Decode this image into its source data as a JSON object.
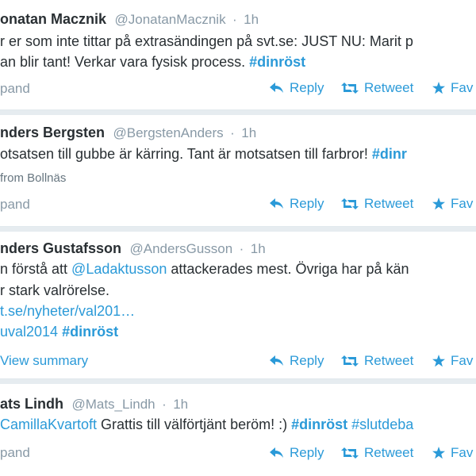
{
  "tweets": [
    {
      "name": "onatan Macznik",
      "handle": "@JonatanMacznik",
      "separator": "·",
      "time": "1h",
      "line1": "r er som inte tittar på extrasändingen på svt.se: JUST NU: Marit p",
      "line2_text": "an blir tant! Verkar vara fysisk process. ",
      "line2_hash": "#dinröst",
      "expand_label": "pand",
      "reply_label": "Reply",
      "retweet_label": "Retweet",
      "fav_label": "Fav"
    },
    {
      "name": "nders Bergsten",
      "handle": "@BergstenAnders",
      "separator": "·",
      "time": "1h",
      "line1_text": "otsatsen till gubbe är kärring. Tant är motsatsen till farbror! ",
      "line1_hash": "#dinr",
      "location": "from Bollnäs",
      "expand_label": "pand",
      "reply_label": "Reply",
      "retweet_label": "Retweet",
      "fav_label": "Fav"
    },
    {
      "name": "nders Gustafsson",
      "handle": "@AndersGusson",
      "separator": "·",
      "time": "1h",
      "line1_pre": "n förstå att ",
      "line1_mention": "@Ladaktusson",
      "line1_post": " attackerades mest. Övriga har på kän",
      "line2": "r stark valrörelse.",
      "line3_link": "t.se/nyheter/val201…",
      "line4_tag1": "uval2014",
      "line4_tag2": "#dinröst",
      "expand_label": "View summary",
      "reply_label": "Reply",
      "retweet_label": "Retweet",
      "fav_label": "Fav"
    },
    {
      "name": "ats Lindh",
      "handle": "@Mats_Lindh",
      "separator": "·",
      "time": "1h",
      "line1_mention": "CamillaKvartoft",
      "line1_text": " Grattis till välförtjänt beröm! :) ",
      "line1_hash1": "#dinröst",
      "line1_hash2": "#slutdeba",
      "expand_label": "pand",
      "reply_label": "Reply",
      "retweet_label": "Retweet",
      "fav_label": "Fav"
    }
  ],
  "colors": {
    "link": "#2b9ad8",
    "text": "#292f33",
    "muted": "#8899a6",
    "divider": "#e1e8ed",
    "background": "#e6ecf0"
  },
  "icons": {
    "reply": "reply-arrow-icon",
    "retweet": "retweet-arrows-icon",
    "favorite": "star-icon"
  }
}
